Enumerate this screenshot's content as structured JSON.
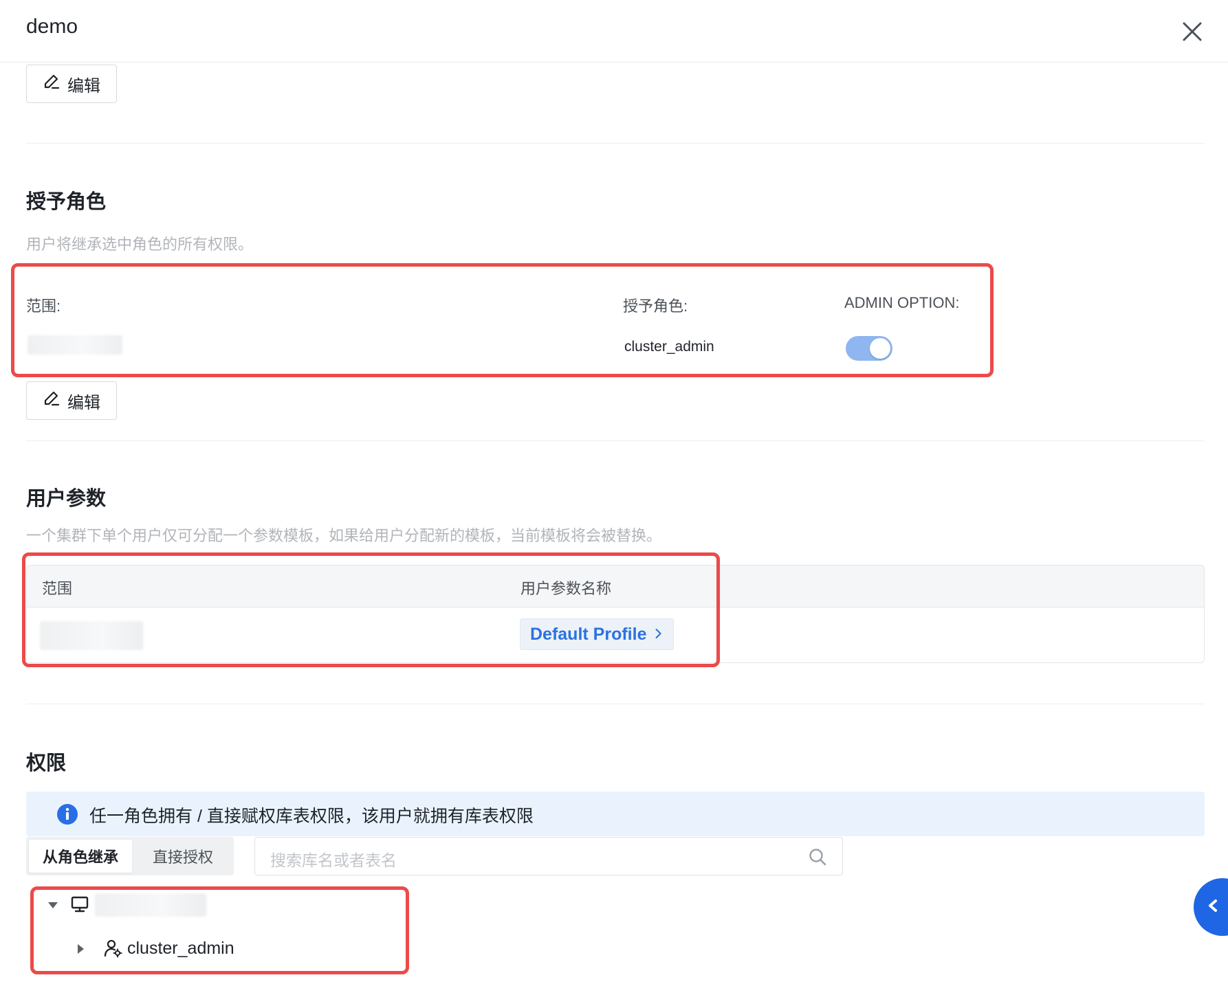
{
  "header": {
    "title": "demo"
  },
  "edit_label": "编辑",
  "grant_roles": {
    "title": "授予角色",
    "description": "用户将继承选中角色的所有权限。",
    "scope_label": "范围:",
    "role_label": "授予角色:",
    "admin_option_label": "ADMIN OPTION:",
    "role_value": "cluster_admin",
    "admin_option_enabled": true
  },
  "user_params": {
    "title": "用户参数",
    "description": "一个集群下单个用户仅可分配一个参数模板，如果给用户分配新的模板，当前模板将会被替换。",
    "col_scope": "范围",
    "col_name": "用户参数名称",
    "profile_link": "Default Profile"
  },
  "permissions": {
    "title": "权限",
    "alert": "任一角色拥有 / 直接赋权库表权限，该用户就拥有库表权限",
    "tabs": [
      "从角色继承",
      "直接授权"
    ],
    "active_tab": "从角色继承",
    "search_placeholder": "搜索库名或者表名",
    "tree_child": "cluster_admin"
  },
  "colors": {
    "accent": "#2a72e0",
    "highlight_border": "#ec4a4a"
  }
}
